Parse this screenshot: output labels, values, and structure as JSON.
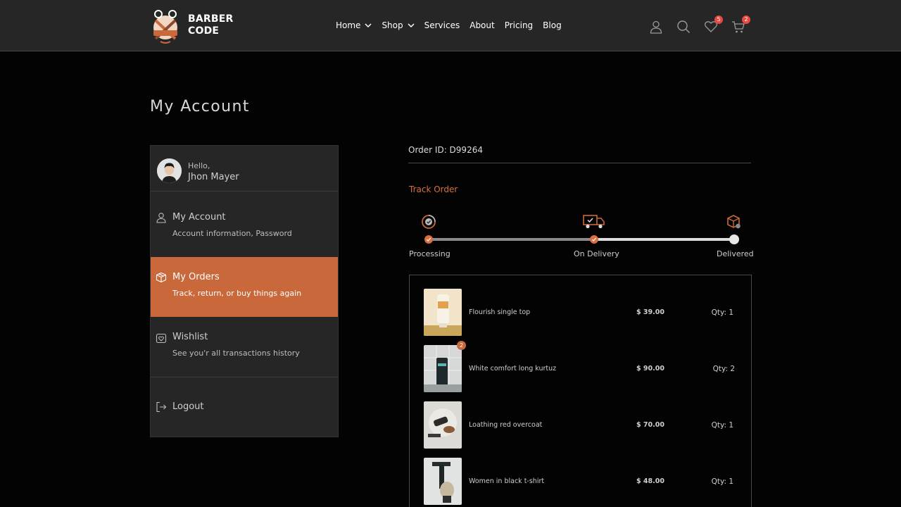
{
  "brand": {
    "line1": "BARBER",
    "line2": "CODE",
    "accent": "#c9683a"
  },
  "nav": [
    {
      "label": "Home",
      "has_dropdown": true
    },
    {
      "label": "Shop",
      "has_dropdown": true
    },
    {
      "label": "Services",
      "has_dropdown": false
    },
    {
      "label": "About",
      "has_dropdown": false
    },
    {
      "label": "Pricing",
      "has_dropdown": false
    },
    {
      "label": "Blog",
      "has_dropdown": false
    }
  ],
  "header_icons": {
    "account": "user-icon",
    "search": "search-icon",
    "wishlist": {
      "icon": "heart-icon",
      "count": "5"
    },
    "cart": {
      "icon": "cart-icon",
      "count": "2"
    }
  },
  "page_title": "My Account",
  "sidebar": {
    "greeting": "Hello,",
    "user_name": "Jhon Mayer",
    "items": [
      {
        "title": "My Account",
        "subtitle": "Account information, Password",
        "icon": "user-icon",
        "active": false
      },
      {
        "title": "My Orders",
        "subtitle": "Track, return, or buy things again",
        "icon": "box-icon",
        "active": true
      },
      {
        "title": "Wishlist",
        "subtitle": "See you'r all transactions history",
        "icon": "heart-box-icon",
        "active": false
      }
    ],
    "logout": {
      "title": "Logout",
      "icon": "logout-icon"
    }
  },
  "order": {
    "id_label": "Order ID: D99264",
    "track_title": "Track Order",
    "steps": [
      {
        "label": "Processing",
        "icon": "processing-icon",
        "done": true
      },
      {
        "label": "On Delivery",
        "icon": "truck-icon",
        "done": true
      },
      {
        "label": "Delivered",
        "icon": "package-icon",
        "done": false
      }
    ],
    "items": [
      {
        "name": "Flourish single top",
        "price": "$ 39.00",
        "qty": "Qty: 1",
        "badge": ""
      },
      {
        "name": "White comfort long kurtuz",
        "price": "$ 90.00",
        "qty": "Qty: 2",
        "badge": "2"
      },
      {
        "name": "Loathing red overcoat",
        "price": "$ 70.00",
        "qty": "Qty: 1",
        "badge": ""
      },
      {
        "name": "Women in black t-shirt",
        "price": "$ 48.00",
        "qty": "Qty: 1",
        "badge": ""
      }
    ]
  }
}
